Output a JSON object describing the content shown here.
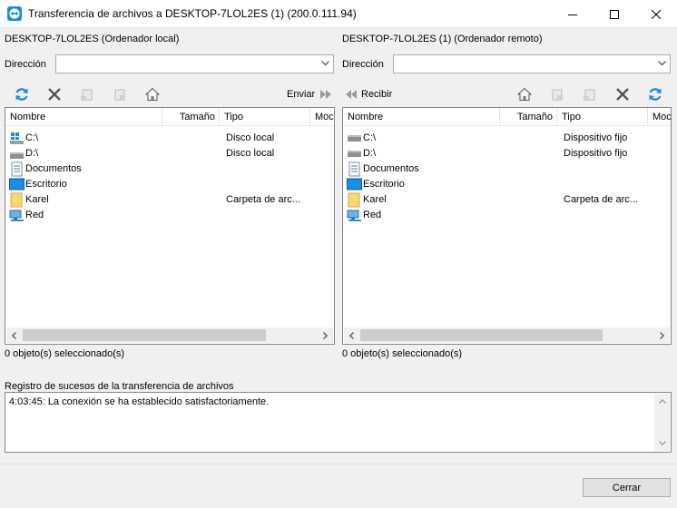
{
  "window": {
    "title": "Transferencia de archivos a DESKTOP-7LOL2ES (1) (200.0.111.94)"
  },
  "local": {
    "title": "DESKTOP-7LOL2ES (Ordenador local)",
    "address_label": "Dirección",
    "address_value": "",
    "send_label": "Enviar",
    "columns": [
      "Nombre",
      "Tamaño",
      "Tipo",
      "Moc"
    ],
    "items": [
      {
        "name": "C:\\",
        "type": "Disco local",
        "icon": "windows-drive-icon"
      },
      {
        "name": "D:\\",
        "type": "Disco local",
        "icon": "drive-icon"
      },
      {
        "name": "Documentos",
        "type": "",
        "icon": "documents-icon"
      },
      {
        "name": "Escritorio",
        "type": "",
        "icon": "desktop-icon"
      },
      {
        "name": "Karel",
        "type": "Carpeta de arc...",
        "icon": "folder-icon"
      },
      {
        "name": "Red",
        "type": "",
        "icon": "network-icon"
      }
    ],
    "status": "0 objeto(s) seleccionado(s)"
  },
  "remote": {
    "title": "DESKTOP-7LOL2ES (1) (Ordenador remoto)",
    "address_label": "Dirección",
    "address_value": "",
    "receive_label": "Recibir",
    "columns": [
      "Nombre",
      "Tamaño",
      "Tipo",
      "Moc"
    ],
    "items": [
      {
        "name": "C:\\",
        "type": "Dispositivo fijo",
        "icon": "drive-icon"
      },
      {
        "name": "D:\\",
        "type": "Dispositivo fijo",
        "icon": "drive-icon"
      },
      {
        "name": "Documentos",
        "type": "",
        "icon": "documents-icon"
      },
      {
        "name": "Escritorio",
        "type": "",
        "icon": "desktop-icon"
      },
      {
        "name": "Karel",
        "type": "Carpeta de arc...",
        "icon": "folder-icon"
      },
      {
        "name": "Red",
        "type": "",
        "icon": "network-icon"
      }
    ],
    "status": "0 objeto(s) seleccionado(s)"
  },
  "log": {
    "title": "Registro de sucesos de la transferencia de archivos",
    "entries": [
      "4:03:45: La conexión se ha establecido satisfactoriamente."
    ]
  },
  "footer": {
    "close_label": "Cerrar"
  },
  "colors": {
    "refresh_blue": "#1e88e5",
    "folder_yellow": "#f8d775",
    "desktop_blue": "#1a8ee0"
  }
}
